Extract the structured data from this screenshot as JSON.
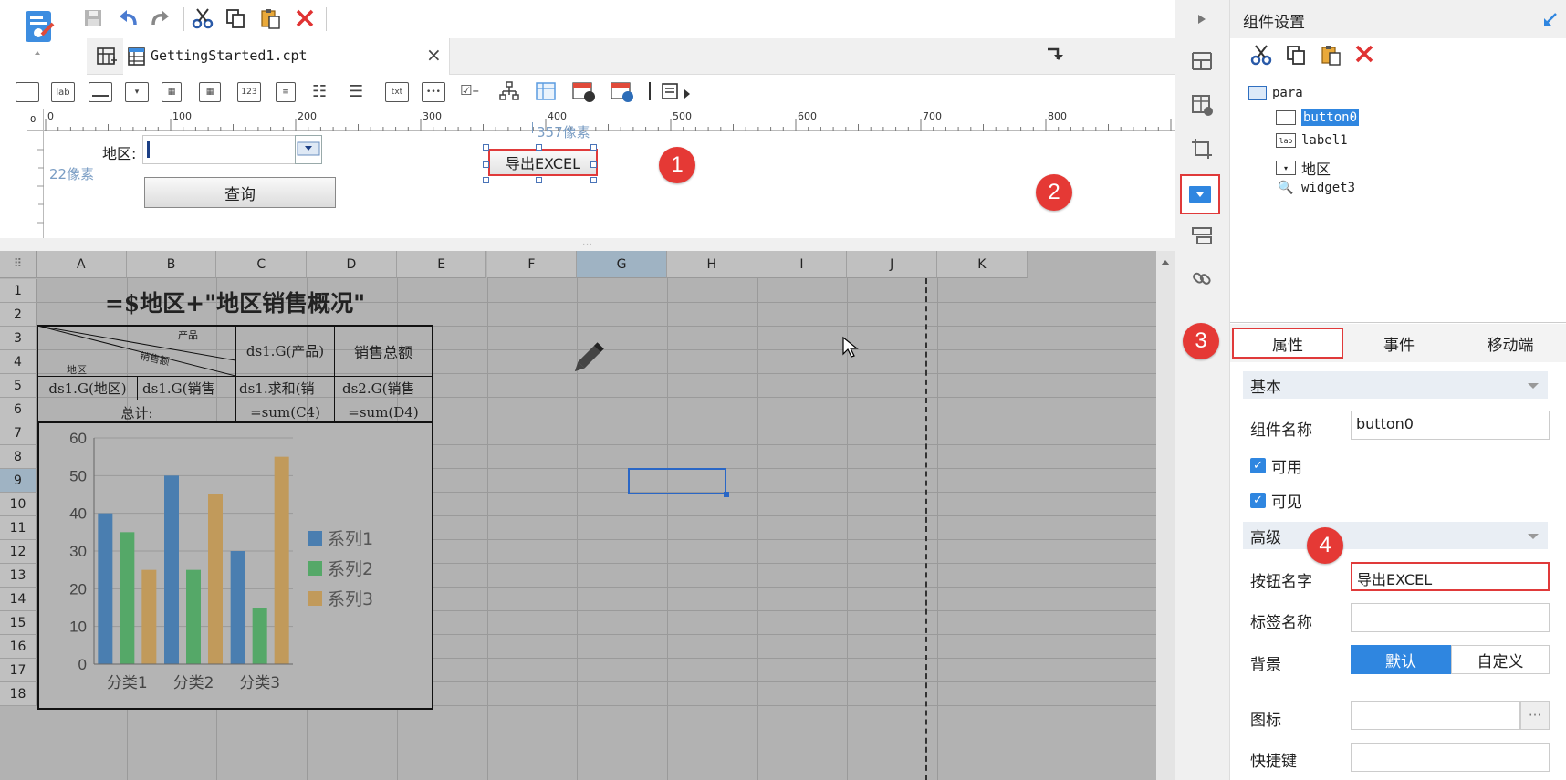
{
  "file_tab": {
    "title": "GettingStarted1.cpt"
  },
  "ruler": {
    "ticks": [
      "0",
      "100",
      "200",
      "300",
      "400",
      "500",
      "600",
      "700",
      "800"
    ]
  },
  "param_pane": {
    "height_annotation": "22像素",
    "width_annotation": "357像素",
    "region_label": "地区:",
    "query_button": "查询",
    "export_button": "导出EXCEL"
  },
  "badges": [
    "1",
    "2",
    "3",
    "4"
  ],
  "sheet": {
    "columns": [
      "A",
      "B",
      "C",
      "D",
      "E",
      "F",
      "G",
      "H",
      "I",
      "J",
      "K"
    ],
    "rows": [
      "1",
      "2",
      "3",
      "4",
      "5",
      "6",
      "7",
      "8",
      "9",
      "10",
      "11",
      "12",
      "13",
      "14",
      "15",
      "16",
      "17",
      "18"
    ],
    "title_formula": "=$地区+\"地区销售概况\"",
    "diag_product": "产品",
    "diag_amount": "销售额",
    "diag_region": "地区",
    "r3_c": "ds1.G(产品)",
    "r3_d": "销售总额",
    "r4_a": "ds1.G(地区)",
    "r4_b": "ds1.G(销售",
    "r4_c": "ds1.求和(销",
    "r4_d": "ds2.G(销售",
    "r5_ab": "总计:",
    "r5_c": "=sum(C4)",
    "r5_d": "=sum(D4)"
  },
  "chart_data": {
    "type": "bar",
    "categories": [
      "分类1",
      "分类2",
      "分类3"
    ],
    "series": [
      {
        "name": "系列1",
        "values": [
          40,
          50,
          30
        ]
      },
      {
        "name": "系列2",
        "values": [
          35,
          25,
          15
        ]
      },
      {
        "name": "系列3",
        "values": [
          25,
          45,
          55
        ]
      }
    ],
    "yticks": [
      "0",
      "10",
      "20",
      "30",
      "40",
      "50",
      "60"
    ],
    "ylim": [
      0,
      60
    ],
    "colors": [
      "#4a7eb0",
      "#55a868",
      "#c19a5b"
    ],
    "grid": true,
    "legend": "right"
  },
  "panel": {
    "title": "组件设置",
    "tree": {
      "root": "para",
      "children": [
        "button0",
        "label1",
        "地区",
        "widget3"
      ]
    },
    "tabs": [
      "属性",
      "事件",
      "移动端"
    ],
    "basic_section": "基本",
    "name_label": "组件名称",
    "name_value": "button0",
    "enabled_label": "可用",
    "visible_label": "可见",
    "advanced_section": "高级",
    "button_name_label": "按钮名字",
    "button_name_value": "导出EXCEL",
    "tag_name_label": "标签名称",
    "background_label": "背景",
    "bg_default": "默认",
    "bg_custom": "自定义",
    "icon_label": "图标",
    "icon_more": "···",
    "shortcut_label": "快捷键"
  },
  "colors": {
    "accent": "#2f86e0",
    "highlight": "#e53935",
    "selection": "#2a67c6"
  }
}
